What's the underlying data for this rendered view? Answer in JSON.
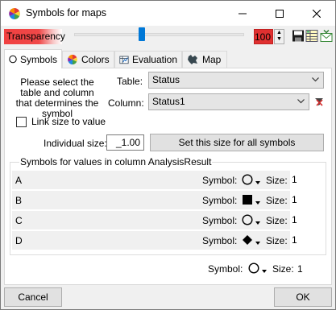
{
  "window": {
    "title": "Symbols for maps",
    "min_icon": "minimize-icon",
    "max_icon": "maximize-icon",
    "close_icon": "close-icon"
  },
  "transparency": {
    "label": "Transparency",
    "value": "100",
    "slider_level": 0.38,
    "label_color": "#f04040"
  },
  "toolbar": {
    "icons": [
      "save-icon",
      "table-icon",
      "mail-icon"
    ]
  },
  "tabs": [
    {
      "label": "Symbols",
      "icon": "circle-icon",
      "active": true
    },
    {
      "label": "Colors",
      "icon": "color-wheel-icon",
      "active": false
    },
    {
      "label": "Evaluation",
      "icon": "evaluation-icon",
      "active": false
    },
    {
      "label": "Map",
      "icon": "map-icon",
      "active": false
    }
  ],
  "instructions": "Please select the table and column that determines the symbol",
  "table": {
    "label": "Table:",
    "value": "Status"
  },
  "column": {
    "label": "Column:",
    "value": "Status1",
    "clear_icon": "clear-filter-icon"
  },
  "link_size": {
    "label": "Link size to value",
    "checked": false
  },
  "individual_size": {
    "label": "Individual size:",
    "value": "_1.00"
  },
  "set_size_button": "Set this size for all symbols",
  "symbols_group": {
    "title": "Symbols for values in column AnalysisResult",
    "rows": [
      {
        "name": "A",
        "symbol_label": "Symbol:",
        "shape": "circle-open",
        "size_label": "Size:",
        "size": "1"
      },
      {
        "name": "B",
        "symbol_label": "Symbol:",
        "shape": "square-filled",
        "size_label": "Size:",
        "size": "1"
      },
      {
        "name": "C",
        "symbol_label": "Symbol:",
        "shape": "circle-open",
        "size_label": "Size:",
        "size": "1"
      },
      {
        "name": "D",
        "symbol_label": "Symbol:",
        "shape": "diamond-filled",
        "size_label": "Size:",
        "size": "1"
      }
    ]
  },
  "default_symbol": {
    "symbol_label": "Symbol:",
    "shape": "circle-open",
    "size_label": "Size:",
    "size": "1"
  },
  "buttons": {
    "cancel": "Cancel",
    "ok": "OK"
  }
}
